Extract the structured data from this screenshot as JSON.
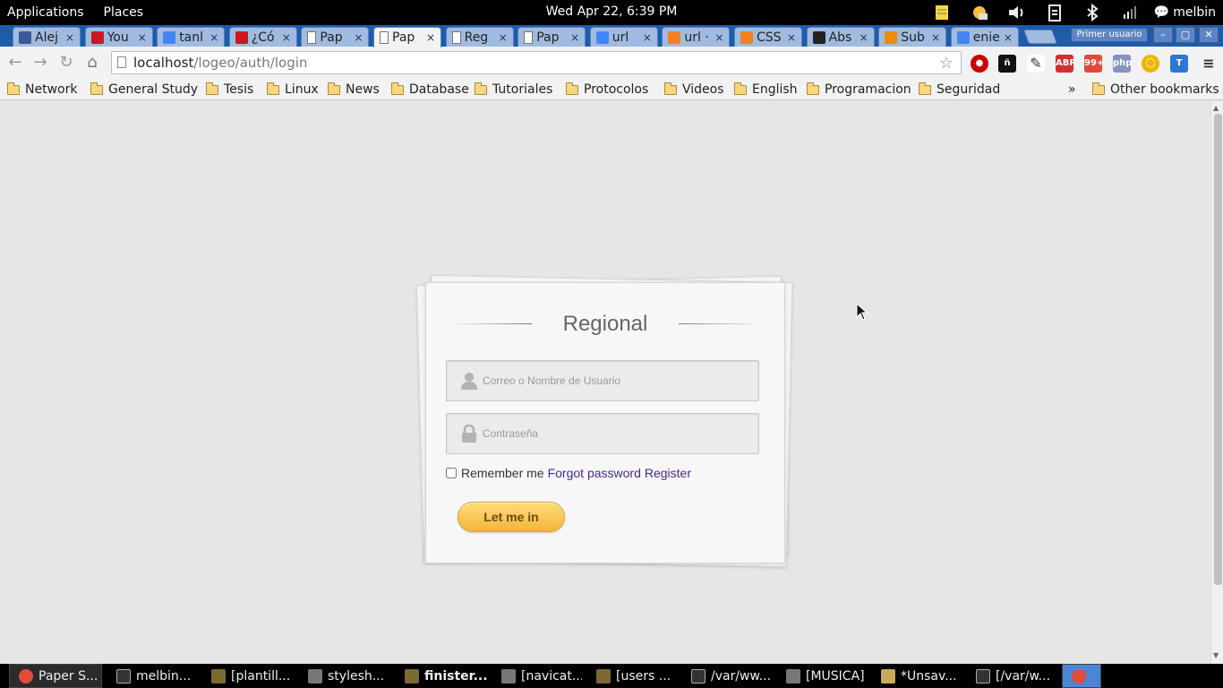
{
  "top_panel": {
    "applications": "Applications",
    "places": "Places",
    "clock": "Wed Apr 22,  6:39 PM",
    "user": "melbin",
    "tray_icons": [
      "notes-icon",
      "weather-icon",
      "volume-icon",
      "clipboard-icon",
      "bluetooth-icon",
      "signal-icon",
      "chat-icon"
    ]
  },
  "tabs": [
    {
      "label": "Alej",
      "icon": "facebook-icon",
      "color": "#3b5998"
    },
    {
      "label": "You",
      "icon": "youtube-icon",
      "color": "#cc181e"
    },
    {
      "label": "tanl",
      "icon": "google-icon",
      "color": "#4285f4"
    },
    {
      "label": "¿Có",
      "icon": "youtube-icon",
      "color": "#cc181e"
    },
    {
      "label": "Pap",
      "icon": "page-icon",
      "color": "#ffffff"
    },
    {
      "label": "Pap",
      "icon": "page-icon",
      "color": "#ffffff",
      "active": true
    },
    {
      "label": "Reg",
      "icon": "page-icon",
      "color": "#ffffff"
    },
    {
      "label": "Pap",
      "icon": "page-icon",
      "color": "#ffffff"
    },
    {
      "label": "url",
      "icon": "google-icon",
      "color": "#4285f4"
    },
    {
      "label": "url ·",
      "icon": "stackoverflow-icon",
      "color": "#f48024"
    },
    {
      "label": "CSS",
      "icon": "stackoverflow-icon",
      "color": "#f48024"
    },
    {
      "label": "Abs",
      "icon": "github-icon",
      "color": "#222222"
    },
    {
      "label": "Sub",
      "icon": "asterisk-icon",
      "color": "#f08a00"
    },
    {
      "label": "enie",
      "icon": "google-icon",
      "color": "#4285f4"
    }
  ],
  "browser": {
    "profile": "Primer usuario",
    "url_host": "localhost",
    "url_path": "/logeo/auth/login"
  },
  "extensions": [
    {
      "name": "stop-icon",
      "color": "#cc0000",
      "text": "●"
    },
    {
      "name": "enye-icon",
      "color": "#111111",
      "text": "ñ"
    },
    {
      "name": "pen-icon",
      "color": "#ffffff",
      "text": "✎"
    },
    {
      "name": "adblock-icon",
      "color": "#d32f2f",
      "text": "ABP"
    },
    {
      "name": "google-mail-checker-icon",
      "color": "#e04a3a",
      "text": "99+"
    },
    {
      "name": "php-icon",
      "color": "#8892be",
      "text": "php"
    },
    {
      "name": "chrome-ring-icon",
      "color": "#f0b400",
      "text": "◯"
    },
    {
      "name": "translate-icon",
      "color": "#2a78d4",
      "text": "T"
    },
    {
      "name": "menu-icon",
      "color": "#f2f2f2",
      "text": "≡"
    }
  ],
  "bookmarks": [
    "Network",
    "General Study",
    "Tesis",
    "Linux",
    "News",
    "Database",
    "Tutoriales",
    "Protocolos",
    "Videos",
    "English",
    "Programacion",
    "Seguridad"
  ],
  "bookmarks_overflow": "»",
  "other_bookmarks": "Other bookmarks",
  "login": {
    "title": "Regional",
    "username_placeholder": "Correo o Nombre de Usuario",
    "password_placeholder": "Contraseña",
    "remember_label": "Remember me",
    "forgot_link": "Forgot password",
    "register_link": "Register",
    "submit_label": "Let me in"
  },
  "taskbar": [
    {
      "label": "Paper S...",
      "icon": "chrome-icon",
      "active": true
    },
    {
      "label": "melbin...",
      "icon": "terminal-icon"
    },
    {
      "label": "[plantill...",
      "icon": "app-icon"
    },
    {
      "label": "stylesh...",
      "icon": "folder-icon"
    },
    {
      "label": "finister...",
      "icon": "app-icon",
      "bold": true
    },
    {
      "label": "[navicat...",
      "icon": "folder-icon"
    },
    {
      "label": "[users ...",
      "icon": "app-icon"
    },
    {
      "label": "/var/ww...",
      "icon": "terminal-icon"
    },
    {
      "label": "[MUSICA]",
      "icon": "folder-icon"
    },
    {
      "label": "*Unsav...",
      "icon": "editor-icon"
    },
    {
      "label": "[/var/w...",
      "icon": "terminal-icon"
    },
    {
      "label": "",
      "icon": "chrome-icon",
      "active": true
    }
  ]
}
